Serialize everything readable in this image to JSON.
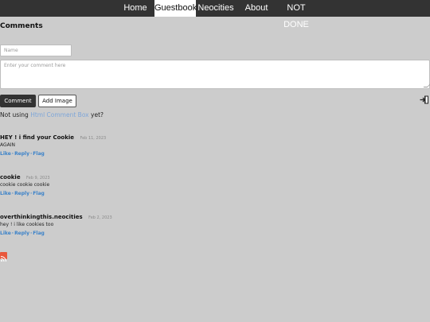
{
  "nav": {
    "items": [
      {
        "label": "Home",
        "active": false
      },
      {
        "label": "Guestbook",
        "active": true
      },
      {
        "label": "Neocities",
        "active": false
      },
      {
        "label": "About",
        "active": false
      },
      {
        "label": "NOT DONE",
        "active": false
      }
    ]
  },
  "guestbook": {
    "title": "Comments",
    "name_placeholder": "Name",
    "comment_placeholder": "Enter your comment here",
    "comment_button": "Comment",
    "add_image_button": "Add Image",
    "promo_prefix": "Not using",
    "promo_link": "Html Comment Box",
    "promo_suffix": "yet?"
  },
  "comments": [
    {
      "author": "HEY ! i find your Cookie",
      "date": "Feb 11, 2023",
      "body": "AGAIN",
      "actions": [
        "Like",
        "Reply",
        "Flag"
      ]
    },
    {
      "author": "cookie",
      "date": "Feb 9, 2023",
      "body": "cookie cookie cookie",
      "actions": [
        "Like",
        "Reply",
        "Flag"
      ]
    },
    {
      "author": "overthinkingthis.neocities",
      "date": "Feb 2, 2023",
      "body": "hey ! i like cookies too",
      "actions": [
        "Like",
        "Reply",
        "Flag"
      ]
    }
  ],
  "icons": {
    "login": "login-icon",
    "rss": "rss-icon"
  },
  "colors": {
    "navbar": "#333333",
    "background": "#cccccc",
    "link": "#3b82c9",
    "promo_link": "#7ea6d9",
    "rss": "#e8573c"
  }
}
